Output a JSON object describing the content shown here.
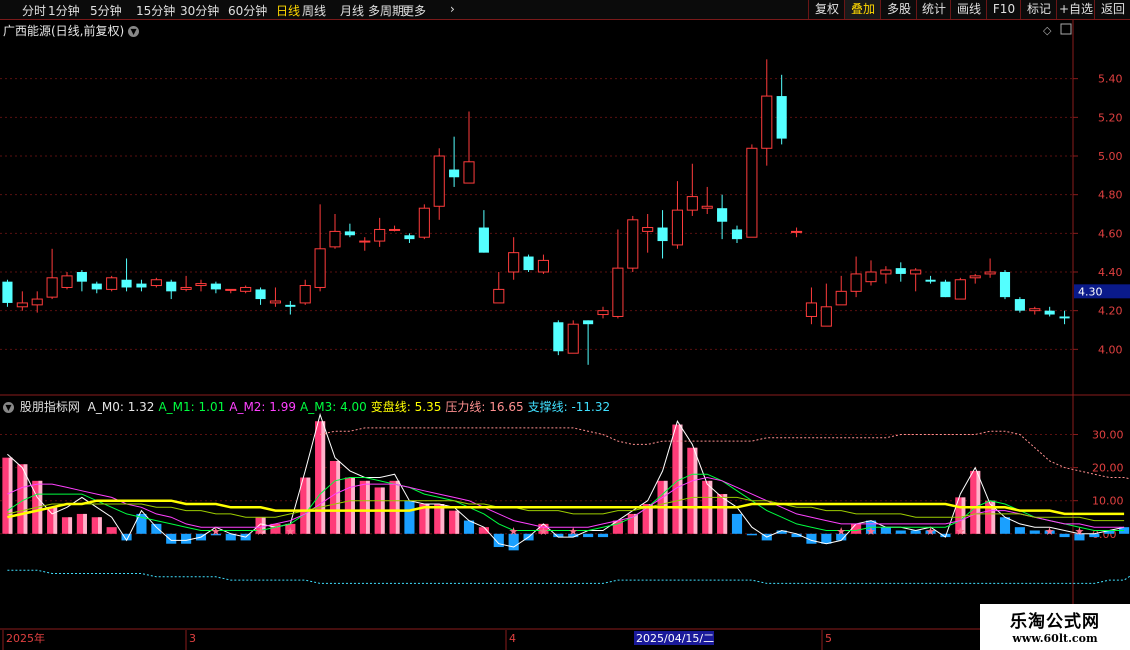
{
  "toolbar": {
    "periods": [
      "分时",
      "1分钟",
      "5分钟",
      "15分钟",
      "30分钟",
      "60分钟",
      "日线",
      "周线",
      "月线",
      "多周期",
      "更多"
    ],
    "active_period": "日线",
    "right_buttons": [
      "复权",
      "叠加",
      "多股",
      "统计",
      "画线",
      "F10",
      "标记",
      "+自选",
      "返回"
    ],
    "active_right": "叠加"
  },
  "stock_title": "广西能源(日线,前复权)",
  "price_axis": [
    "5.40",
    "5.20",
    "5.00",
    "4.80",
    "4.60",
    "4.40",
    "4.20",
    "4.00"
  ],
  "current_price": "4.30",
  "indicator": {
    "name": "股朋指标网",
    "items": [
      {
        "label": "A_M0:",
        "value": "1.32",
        "color": "#e8e8e8"
      },
      {
        "label": "A_M1:",
        "value": "1.01",
        "color": "#00ff40"
      },
      {
        "label": "A_M2:",
        "value": "1.99",
        "color": "#ff40ff"
      },
      {
        "label": "A_M3:",
        "value": "4.00",
        "color": "#00ff40"
      },
      {
        "label": "变盘线:",
        "value": "5.35",
        "color": "#ffff00"
      },
      {
        "label": "压力线:",
        "value": "16.65",
        "color": "#ff9090"
      },
      {
        "label": "支撑线:",
        "value": "-11.32",
        "color": "#40e0ff"
      }
    ]
  },
  "indicator_axis": [
    "30.00",
    "20.00",
    "10.00",
    "0.00"
  ],
  "date_axis": {
    "labels": [
      "2025年",
      "3",
      "4",
      "5"
    ],
    "highlight": "2025/04/15/二"
  },
  "chart_data": {
    "type": "candlestick",
    "price_ylim": [
      3.8,
      5.6
    ],
    "candles": [
      [
        4.35,
        4.24,
        4.36,
        4.22
      ],
      [
        4.22,
        4.24,
        4.3,
        4.2
      ],
      [
        4.23,
        4.26,
        4.3,
        4.19
      ],
      [
        4.27,
        4.37,
        4.52,
        4.26
      ],
      [
        4.32,
        4.38,
        4.4,
        4.31
      ],
      [
        4.4,
        4.35,
        4.41,
        4.3
      ],
      [
        4.34,
        4.31,
        4.35,
        4.29
      ],
      [
        4.31,
        4.37,
        4.38,
        4.3
      ],
      [
        4.36,
        4.32,
        4.47,
        4.3
      ],
      [
        4.34,
        4.32,
        4.36,
        4.3
      ],
      [
        4.33,
        4.36,
        4.37,
        4.32
      ],
      [
        4.35,
        4.3,
        4.36,
        4.26
      ],
      [
        4.31,
        4.32,
        4.38,
        4.3
      ],
      [
        4.33,
        4.34,
        4.36,
        4.3
      ],
      [
        4.34,
        4.31,
        4.35,
        4.29
      ],
      [
        4.31,
        4.31,
        4.31,
        4.29
      ],
      [
        4.3,
        4.32,
        4.33,
        4.29
      ],
      [
        4.31,
        4.26,
        4.32,
        4.23
      ],
      [
        4.24,
        4.25,
        4.32,
        4.22
      ],
      [
        4.23,
        4.22,
        4.25,
        4.18
      ],
      [
        4.24,
        4.33,
        4.36,
        4.23
      ],
      [
        4.32,
        4.52,
        4.75,
        4.3
      ],
      [
        4.53,
        4.61,
        4.7,
        4.52
      ],
      [
        4.61,
        4.59,
        4.65,
        4.58
      ],
      [
        4.56,
        4.56,
        4.58,
        4.51
      ],
      [
        4.56,
        4.62,
        4.68,
        4.53
      ],
      [
        4.62,
        4.62,
        4.64,
        4.61
      ],
      [
        4.59,
        4.57,
        4.6,
        4.55
      ],
      [
        4.58,
        4.73,
        4.75,
        4.57
      ],
      [
        4.74,
        5.0,
        5.04,
        4.67
      ],
      [
        4.93,
        4.89,
        5.1,
        4.84
      ],
      [
        4.86,
        4.97,
        5.23,
        4.86
      ],
      [
        4.63,
        4.5,
        4.72,
        4.5
      ],
      [
        4.24,
        4.31,
        4.4,
        4.24
      ],
      [
        4.4,
        4.5,
        4.58,
        4.36
      ],
      [
        4.48,
        4.41,
        4.49,
        4.4
      ],
      [
        4.4,
        4.46,
        4.49,
        4.39
      ],
      [
        4.14,
        3.99,
        4.15,
        3.97
      ],
      [
        3.98,
        4.13,
        4.15,
        3.98
      ],
      [
        4.15,
        4.13,
        4.15,
        3.92
      ],
      [
        4.18,
        4.2,
        4.22,
        4.16
      ],
      [
        4.17,
        4.42,
        4.62,
        4.16
      ],
      [
        4.42,
        4.67,
        4.69,
        4.4
      ],
      [
        4.61,
        4.63,
        4.7,
        4.5
      ],
      [
        4.63,
        4.56,
        4.72,
        4.47
      ],
      [
        4.54,
        4.72,
        4.87,
        4.52
      ],
      [
        4.72,
        4.79,
        4.96,
        4.69
      ],
      [
        4.73,
        4.74,
        4.84,
        4.7
      ],
      [
        4.73,
        4.66,
        4.8,
        4.57
      ],
      [
        4.62,
        4.57,
        4.64,
        4.55
      ],
      [
        4.58,
        5.04,
        5.06,
        4.58
      ],
      [
        5.04,
        5.31,
        5.5,
        4.95
      ],
      [
        5.31,
        5.09,
        5.42,
        5.06
      ],
      [
        4.61,
        4.61,
        4.63,
        4.58
      ],
      [
        4.17,
        4.24,
        4.32,
        4.13
      ],
      [
        4.12,
        4.22,
        4.34,
        4.12
      ],
      [
        4.23,
        4.3,
        4.38,
        4.23
      ],
      [
        4.3,
        4.39,
        4.48,
        4.27
      ],
      [
        4.35,
        4.4,
        4.46,
        4.33
      ],
      [
        4.39,
        4.41,
        4.43,
        4.34
      ],
      [
        4.42,
        4.39,
        4.45,
        4.35
      ],
      [
        4.39,
        4.41,
        4.42,
        4.3
      ],
      [
        4.36,
        4.35,
        4.38,
        4.34
      ],
      [
        4.35,
        4.27,
        4.36,
        4.27
      ],
      [
        4.26,
        4.36,
        4.37,
        4.26
      ],
      [
        4.37,
        4.38,
        4.39,
        4.34
      ],
      [
        4.39,
        4.4,
        4.47,
        4.37
      ],
      [
        4.4,
        4.27,
        4.41,
        4.26
      ],
      [
        4.26,
        4.2,
        4.27,
        4.19
      ],
      [
        4.2,
        4.21,
        4.22,
        4.18
      ],
      [
        4.2,
        4.18,
        4.22,
        4.17
      ],
      [
        4.17,
        4.16,
        4.2,
        4.13
      ]
    ],
    "indicator_ylim": [
      -20,
      38
    ],
    "histogram": [
      23,
      21,
      16,
      8,
      5,
      6,
      5,
      2,
      -2,
      6,
      3,
      -3,
      -3,
      -2,
      0,
      -2,
      -2,
      5,
      3,
      3,
      17,
      34,
      22,
      17,
      16,
      14,
      16,
      10,
      9,
      9,
      7,
      4,
      2,
      -4,
      -5,
      -2,
      3,
      -1,
      -1,
      -1,
      -1,
      4,
      6,
      9,
      16,
      33,
      26,
      16,
      12,
      6,
      0,
      -2,
      1,
      -1,
      -3,
      -3,
      -2,
      3,
      4,
      2,
      1,
      1,
      1,
      -1,
      11,
      19,
      10,
      5,
      2,
      1,
      1,
      -1,
      -2,
      -1,
      1,
      2
    ],
    "pink_flags": [
      1,
      1,
      1,
      1,
      1,
      1,
      1,
      1,
      1,
      0,
      0,
      1,
      1,
      0,
      0,
      0,
      0,
      1,
      1,
      1,
      1,
      1,
      1,
      1,
      1,
      1,
      1,
      0,
      1,
      1,
      1,
      0,
      1,
      0,
      0,
      0,
      1,
      1,
      1,
      1,
      1,
      1,
      1,
      1,
      1,
      1,
      1,
      1,
      1,
      0,
      0,
      0,
      0,
      1,
      1,
      1,
      1,
      1,
      0,
      0,
      0,
      0,
      0,
      0,
      1,
      1,
      1,
      0,
      0,
      0,
      0,
      0,
      0,
      0,
      0,
      0
    ],
    "series": [
      {
        "name": "A_M0",
        "color": "#e8e8e8"
      },
      {
        "name": "A_M1",
        "color": "#00ff40"
      },
      {
        "name": "A_M2",
        "color": "#ff40ff"
      },
      {
        "name": "A_M3",
        "color": "#00ff40"
      },
      {
        "name": "变盘线",
        "color": "#ffff00"
      },
      {
        "name": "压力线",
        "color": "#ff9090"
      },
      {
        "name": "支撑线",
        "color": "#40e0ff"
      }
    ],
    "star_positions": [
      14,
      17,
      19,
      34,
      36,
      38,
      56,
      58,
      62,
      64,
      70,
      72
    ],
    "line_values": {
      "A_M0": [
        24,
        20,
        11,
        6,
        8,
        11,
        8,
        5,
        -2,
        7,
        2,
        -2,
        -2,
        -1,
        2,
        0,
        -1,
        3,
        2,
        3,
        19,
        36,
        23,
        19,
        17,
        17,
        18,
        10,
        9,
        9,
        8,
        4,
        2,
        -3,
        -4,
        -1,
        3,
        -1,
        -1,
        1,
        1,
        4,
        7,
        10,
        19,
        34,
        27,
        15,
        11,
        8,
        2,
        -1,
        1,
        0,
        -2,
        -3,
        -2,
        3,
        4,
        2,
        2,
        1,
        2,
        -1,
        12,
        20,
        9,
        5,
        3,
        2,
        2,
        1,
        0,
        0,
        1,
        2
      ],
      "A_M1": [
        7,
        10,
        12,
        12,
        12,
        12,
        10,
        8,
        6,
        5,
        4,
        3,
        2,
        1,
        1,
        1,
        1,
        1,
        2,
        3,
        6,
        12,
        16,
        17,
        17,
        16,
        15,
        14,
        12,
        11,
        10,
        8,
        6,
        3,
        1,
        1,
        1,
        1,
        1,
        1,
        2,
        3,
        5,
        8,
        12,
        16,
        18,
        18,
        16,
        13,
        10,
        7,
        5,
        3,
        2,
        1,
        1,
        1,
        2,
        2,
        2,
        2,
        2,
        2,
        4,
        8,
        10,
        9,
        7,
        5,
        4,
        3,
        2,
        1,
        1,
        1
      ],
      "A_M2": [
        12,
        14,
        15,
        15,
        14,
        13,
        12,
        11,
        9,
        8,
        6,
        5,
        3,
        2,
        2,
        2,
        2,
        2,
        3,
        4,
        6,
        9,
        12,
        14,
        15,
        15,
        15,
        14,
        13,
        12,
        11,
        10,
        8,
        6,
        4,
        3,
        2,
        2,
        2,
        2,
        3,
        4,
        5,
        8,
        11,
        14,
        16,
        17,
        16,
        14,
        12,
        10,
        8,
        6,
        5,
        4,
        3,
        3,
        3,
        3,
        3,
        3,
        3,
        3,
        4,
        6,
        7,
        7,
        6,
        5,
        4,
        3,
        3,
        2,
        2,
        2
      ],
      "A_M3": [
        6,
        7,
        8,
        9,
        9,
        9,
        9,
        9,
        9,
        9,
        8,
        8,
        7,
        7,
        6,
        6,
        5,
        5,
        5,
        6,
        7,
        8,
        9,
        10,
        10,
        10,
        10,
        10,
        10,
        10,
        10,
        9,
        9,
        8,
        8,
        7,
        7,
        7,
        6,
        6,
        6,
        7,
        7,
        8,
        9,
        10,
        11,
        11,
        11,
        11,
        10,
        10,
        9,
        8,
        8,
        7,
        7,
        6,
        6,
        6,
        6,
        5,
        5,
        5,
        5,
        6,
        6,
        6,
        6,
        5,
        5,
        5,
        5,
        4,
        4,
        4
      ],
      "变盘线": [
        5,
        6,
        7,
        8,
        9,
        9,
        10,
        10,
        10,
        10,
        10,
        10,
        9,
        9,
        9,
        8,
        8,
        8,
        7,
        7,
        7,
        7,
        7,
        7,
        7,
        7,
        7,
        7,
        8,
        8,
        8,
        8,
        8,
        8,
        8,
        8,
        8,
        8,
        8,
        8,
        8,
        8,
        8,
        8,
        8,
        8,
        8,
        8,
        8,
        8,
        9,
        9,
        9,
        9,
        9,
        9,
        9,
        9,
        9,
        9,
        9,
        9,
        9,
        9,
        8,
        8,
        8,
        8,
        7,
        7,
        7,
        6,
        6,
        6,
        6,
        6
      ],
      "压力线": [
        null,
        null,
        null,
        null,
        null,
        null,
        null,
        null,
        null,
        null,
        null,
        null,
        null,
        null,
        null,
        null,
        null,
        null,
        null,
        null,
        null,
        30,
        31,
        31,
        32,
        32,
        32,
        32,
        32,
        32,
        32,
        32,
        32,
        32,
        32,
        32,
        32,
        32,
        32,
        31,
        30,
        28,
        27,
        27,
        28,
        28,
        28,
        28,
        28,
        28,
        28,
        29,
        29,
        29,
        29,
        29,
        29,
        29,
        29,
        29,
        30,
        30,
        30,
        30,
        30,
        30,
        31,
        31,
        30,
        26,
        22,
        20,
        19,
        18,
        17,
        17,
        16
      ],
      "支撑线": [
        -11,
        -11,
        -11,
        -12,
        -12,
        -12,
        -12,
        -12,
        -12,
        -12,
        -13,
        -13,
        -13,
        -13,
        -13,
        -14,
        -14,
        -14,
        -14,
        -14,
        -14,
        -15,
        -15,
        -15,
        -15,
        -15,
        -15,
        -15,
        -15,
        -15,
        -15,
        -15,
        -15,
        -15,
        -15,
        -15,
        -15,
        -15,
        -15,
        -15,
        -15,
        -14,
        -14,
        -14,
        -14,
        -14,
        -14,
        -14,
        -14,
        -14,
        -14,
        -15,
        -15,
        -15,
        -15,
        -15,
        -15,
        -15,
        -15,
        -15,
        -15,
        -15,
        -15,
        -15,
        -15,
        -15,
        -15,
        -15,
        -15,
        -15,
        -15,
        -15,
        -15,
        -15,
        -14,
        -14,
        -11
      ]
    }
  },
  "watermark": {
    "line1": "乐淘公式网",
    "line2": "www.60lt.com"
  }
}
